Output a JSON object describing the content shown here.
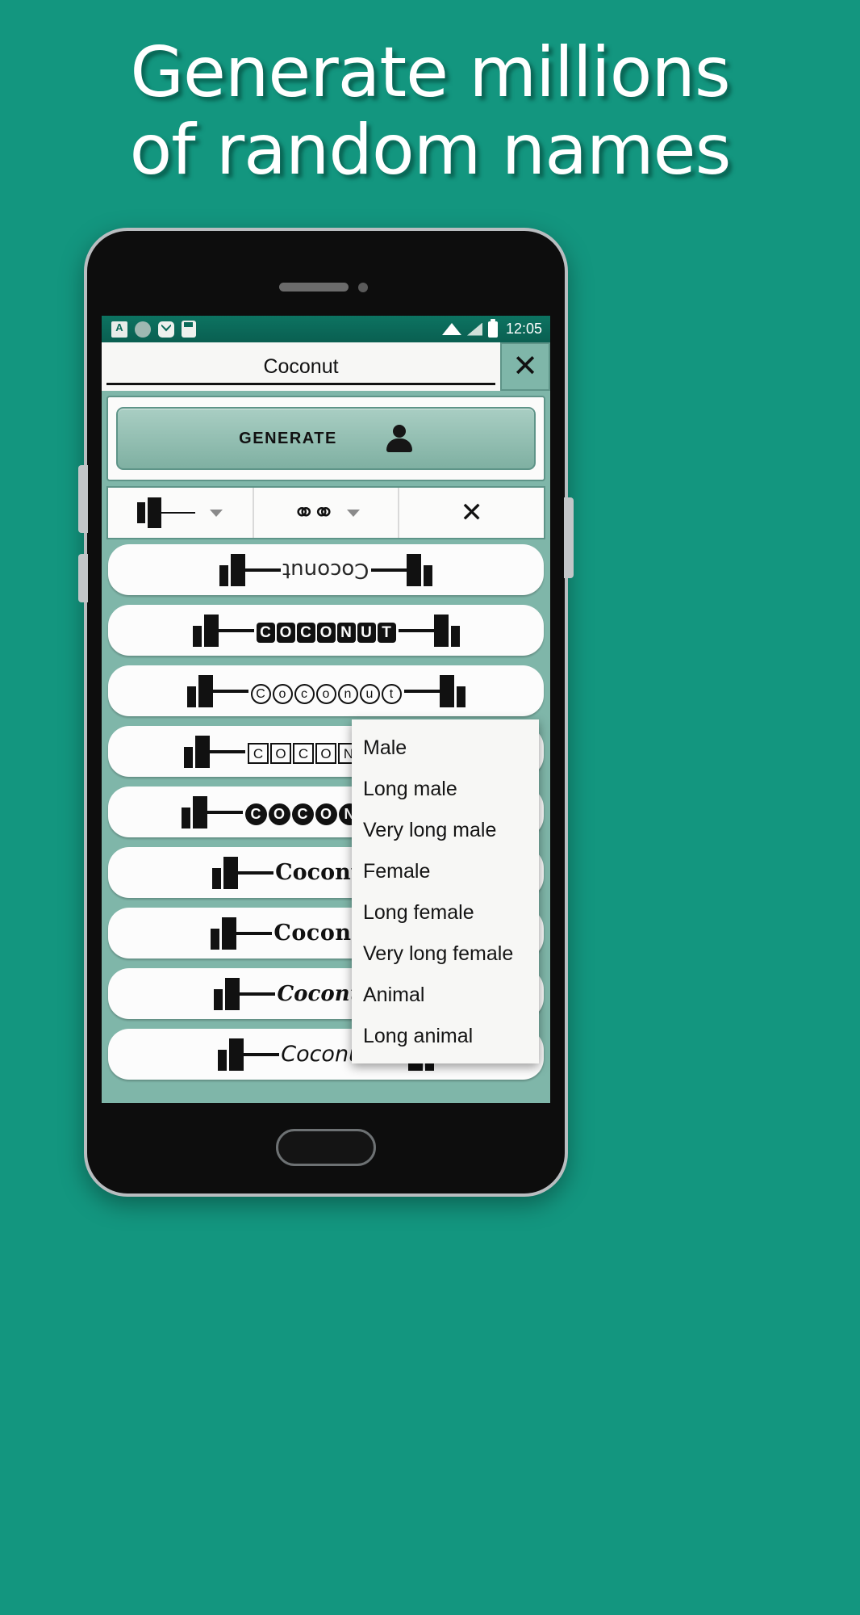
{
  "headline": {
    "line1": "Generate millions",
    "line2": "of random names"
  },
  "colors": {
    "background": "#13967f",
    "accent": "#7fb6a9",
    "statusbar": "#0b6b5a",
    "panel": "#fbfbfa"
  },
  "statusbar": {
    "icons": [
      "a-translate-icon",
      "circle-icon",
      "checkmark-shield-icon",
      "sim-card-icon"
    ],
    "wifi": "wifi-icon",
    "signal": "signal-icon",
    "battery": "battery-icon",
    "time": "12:05"
  },
  "search": {
    "value": "Coconut",
    "placeholder": "Coconut",
    "close_label": "✕"
  },
  "generate": {
    "label": "GENERATE",
    "icon": "person-icon"
  },
  "options": {
    "style_caret": "▾",
    "link_icon": "link-icon",
    "link_caret": "▾",
    "clear_label": "✕"
  },
  "dropdown": {
    "items": [
      {
        "label": "Male"
      },
      {
        "label": "Long male"
      },
      {
        "label": "Very long male"
      },
      {
        "label": "Female"
      },
      {
        "label": "Long female"
      },
      {
        "label": "Very long female"
      },
      {
        "label": "Animal"
      },
      {
        "label": "Long animal"
      }
    ]
  },
  "results": {
    "rows": [
      {
        "text": "Coconut",
        "style": "n-partial"
      },
      {
        "text": "COCONUT",
        "style": "n-blackbox"
      },
      {
        "text": "Coconut",
        "style": "n-circle"
      },
      {
        "text": "COCONUT",
        "style": "n-square"
      },
      {
        "text": "COCONUT",
        "style": "n-fillcircle"
      },
      {
        "text": "Coconut",
        "style": "n-fraktur"
      },
      {
        "text": "Coconut",
        "style": "n-fraktur2"
      },
      {
        "text": "Coconut",
        "style": "n-script"
      },
      {
        "text": "Coconut",
        "style": "n-italic"
      }
    ]
  }
}
